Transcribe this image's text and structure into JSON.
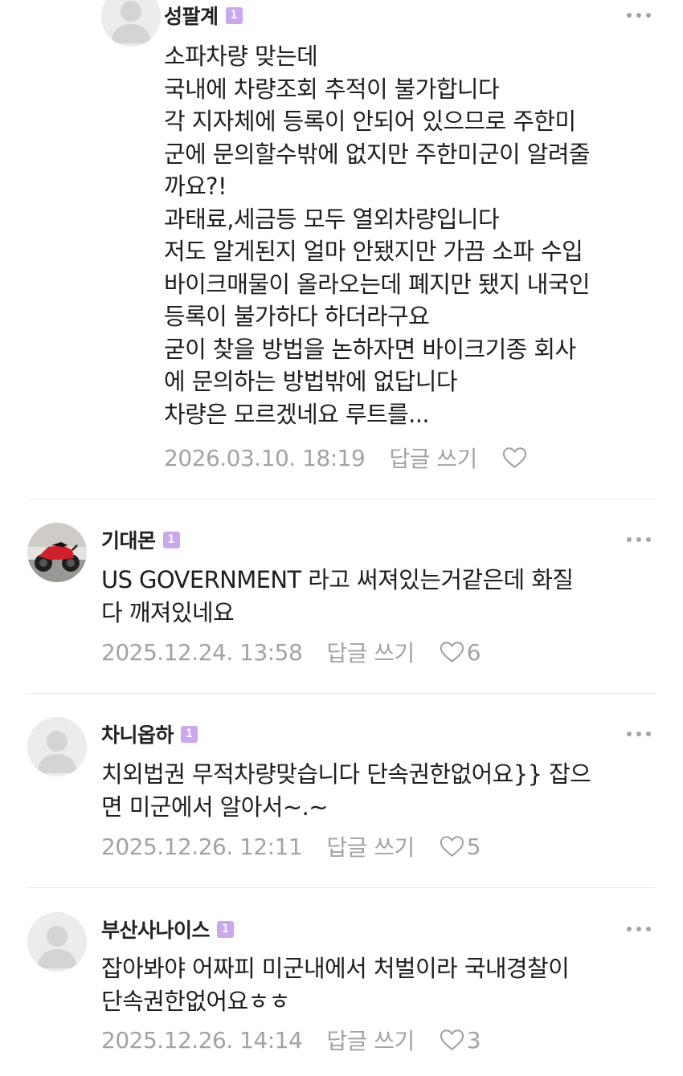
{
  "comments": [
    {
      "author": "성팔계",
      "level_badge": "1",
      "text": "소파차량 맞는데\n국내에 차량조회 추적이 불가합니다\n각 지자체에 등록이 안되어 있으므로 주한미\n군에 문의할수밖에 없지만 주한미군이 알려줄\n까요?!\n과태료,세금등 모두 열외차량입니다\n저도 알게된지 얼마 안됐지만 가끔 소파 수입\n바이크매물이 올라오는데 폐지만 됐지 내국인\n등록이 불가하다 하더라구요\n굳이 찾을 방법을 논하자면 바이크기종 회사\n에 문의하는 방법밖에 없답니다\n차량은 모르겠네요 루트를...",
      "date": "2026.03.10. 18:19",
      "reply_label": "답글 쓰기",
      "likes": "",
      "avatar": "default-avatar"
    },
    {
      "author": "기대몬",
      "level_badge": "1",
      "text": "US GOVERNMENT 라고 써져있는거같은데 화질\n다 깨져있네요",
      "date": "2025.12.24. 13:58",
      "reply_label": "답글 쓰기",
      "likes": "6",
      "avatar": "motorcycle-photo"
    },
    {
      "author": "차니옵하",
      "level_badge": "1",
      "text": "치외법권 무적차량맞습니다 단속권한없어요}} 잡으\n면 미군에서 알아서~.~",
      "date": "2025.12.26. 12:11",
      "reply_label": "답글 쓰기",
      "likes": "5",
      "avatar": "default-avatar"
    },
    {
      "author": "부산사나이스",
      "level_badge": "1",
      "text": "잡아봐야 어짜피 미군내에서 처벌이라 국내경찰이\n단속권한없어요ㅎㅎ",
      "date": "2025.12.26. 14:14",
      "reply_label": "답글 쓰기",
      "likes": "3",
      "avatar": "default-avatar"
    }
  ],
  "colors": {
    "badge": "#c9a9ec",
    "meta_text": "#a3a3a3",
    "divider": "#ebebeb",
    "avatar_bg": "#ececee",
    "motorcycle_red": "#d0202a"
  },
  "icons": {
    "more": "more-dots-icon",
    "like": "heart-outline-icon",
    "avatar": "person-silhouette-icon"
  }
}
